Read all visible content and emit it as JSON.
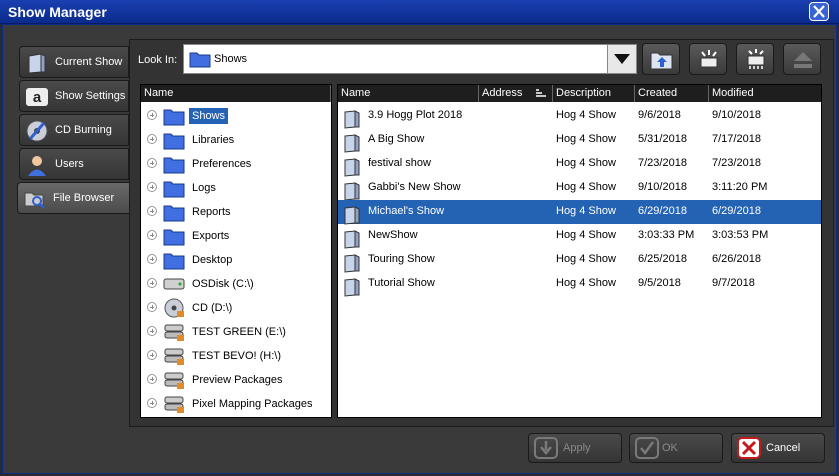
{
  "window": {
    "title": "Show Manager"
  },
  "sidebar": {
    "items": [
      {
        "label": "Current Show",
        "icon": "current-show-icon"
      },
      {
        "label": "Show Settings",
        "icon": "show-settings-icon"
      },
      {
        "label": "CD Burning",
        "icon": "cd-burning-icon"
      },
      {
        "label": "Users",
        "icon": "users-icon"
      },
      {
        "label": "File Browser",
        "icon": "file-browser-icon",
        "active": true
      }
    ]
  },
  "lookin": {
    "label": "Look In:",
    "value": "Shows"
  },
  "tree": {
    "header": "Name",
    "items": [
      {
        "label": "Shows",
        "icon": "folder-icon",
        "selected": true
      },
      {
        "label": "Libraries",
        "icon": "folder-icon"
      },
      {
        "label": "Preferences",
        "icon": "folder-icon"
      },
      {
        "label": "Logs",
        "icon": "folder-icon"
      },
      {
        "label": "Reports",
        "icon": "folder-icon"
      },
      {
        "label": "Exports",
        "icon": "folder-icon"
      },
      {
        "label": "Desktop",
        "icon": "folder-icon"
      },
      {
        "label": "OSDisk (C:\\)",
        "icon": "disk-icon"
      },
      {
        "label": "CD (D:\\)",
        "icon": "cd-drive-icon"
      },
      {
        "label": "TEST GREEN (E:\\)",
        "icon": "drive-icon"
      },
      {
        "label": "TEST BEVO! (H:\\)",
        "icon": "drive-icon"
      },
      {
        "label": "Preview Packages",
        "icon": "drive-icon"
      },
      {
        "label": "Pixel Mapping Packages",
        "icon": "drive-icon"
      }
    ]
  },
  "files": {
    "columns": [
      "Name",
      "Address",
      "Description",
      "Created",
      "Modified"
    ],
    "rows": [
      {
        "name": "3.9 Hogg Plot 2018",
        "address": "",
        "description": "Hog 4 Show",
        "created": "9/6/2018",
        "modified": "9/10/2018"
      },
      {
        "name": "A Big Show",
        "address": "",
        "description": "Hog 4 Show",
        "created": "5/31/2018",
        "modified": "7/17/2018"
      },
      {
        "name": "festival show",
        "address": "",
        "description": "Hog 4 Show",
        "created": "7/23/2018",
        "modified": "7/23/2018"
      },
      {
        "name": "Gabbi's New Show",
        "address": "",
        "description": "Hog 4 Show",
        "created": "9/10/2018",
        "modified": "3:11:20 PM"
      },
      {
        "name": "Michael's Show",
        "address": "",
        "description": "Hog 4 Show",
        "created": "6/29/2018",
        "modified": "6/29/2018",
        "selected": true
      },
      {
        "name": "NewShow",
        "address": "",
        "description": "Hog 4 Show",
        "created": "3:03:33 PM",
        "modified": "3:03:53 PM"
      },
      {
        "name": "Touring Show",
        "address": "",
        "description": "Hog 4 Show",
        "created": "6/25/2018",
        "modified": "6/26/2018"
      },
      {
        "name": "Tutorial Show",
        "address": "",
        "description": "Hog 4 Show",
        "created": "9/5/2018",
        "modified": "9/7/2018"
      }
    ]
  },
  "buttons": {
    "apply": "Apply",
    "ok": "OK",
    "cancel": "Cancel"
  },
  "colors": {
    "titlebar": "#0a2a8c",
    "selection": "#2463b3",
    "folder": "#3f6fe0"
  }
}
